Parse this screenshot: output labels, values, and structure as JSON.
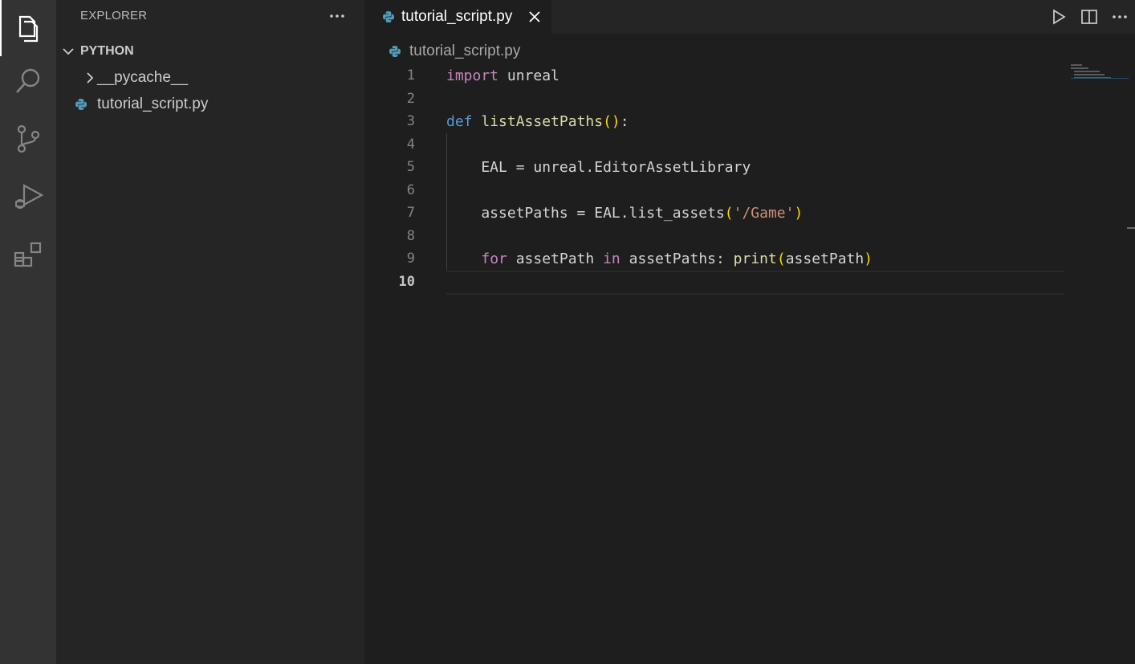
{
  "activity_bar": {
    "items": [
      {
        "name": "explorer",
        "icon": "files-icon",
        "active": true
      },
      {
        "name": "search",
        "icon": "search-icon",
        "active": false
      },
      {
        "name": "source-control",
        "icon": "source-control-icon",
        "active": false
      },
      {
        "name": "run-debug",
        "icon": "run-debug-icon",
        "active": false
      },
      {
        "name": "extensions",
        "icon": "extensions-icon",
        "active": false
      }
    ]
  },
  "sidebar": {
    "title": "EXPLORER",
    "more_icon": "ellipsis-icon",
    "folder": {
      "name": "PYTHON",
      "expanded": true
    },
    "items": [
      {
        "label": "__pycache__",
        "type": "folder",
        "icon": "chevron-right-icon"
      },
      {
        "label": "tutorial_script.py",
        "type": "file",
        "icon": "python-file-icon"
      }
    ]
  },
  "editor": {
    "tabs": [
      {
        "label": "tutorial_script.py",
        "icon": "python-file-icon",
        "active": true
      }
    ],
    "actions": [
      {
        "name": "run",
        "icon": "play-icon"
      },
      {
        "name": "split",
        "icon": "split-editor-icon"
      },
      {
        "name": "more",
        "icon": "ellipsis-icon"
      }
    ],
    "breadcrumb": "tutorial_script.py",
    "current_line": 10,
    "lines": [
      {
        "num": "1",
        "text": "import unreal"
      },
      {
        "num": "2",
        "text": ""
      },
      {
        "num": "3",
        "text": "def listAssetPaths():"
      },
      {
        "num": "4",
        "text": ""
      },
      {
        "num": "5",
        "text": "    EAL = unreal.EditorAssetLibrary"
      },
      {
        "num": "6",
        "text": ""
      },
      {
        "num": "7",
        "text": "    assetPaths = EAL.list_assets('/Game')"
      },
      {
        "num": "8",
        "text": ""
      },
      {
        "num": "9",
        "text": "    for assetPath in assetPaths: print(assetPath)"
      },
      {
        "num": "10",
        "text": ""
      }
    ]
  },
  "colors": {
    "activity_bg": "#333333",
    "sidebar_bg": "#252526",
    "editor_bg": "#1e1e1e",
    "keyword_purple": "#c586c0",
    "keyword_blue": "#569cd6",
    "function_yellow": "#dcdcaa",
    "bracket_gold": "#ffd700",
    "string_orange": "#ce9178",
    "python_icon_blue": "#519aba"
  }
}
